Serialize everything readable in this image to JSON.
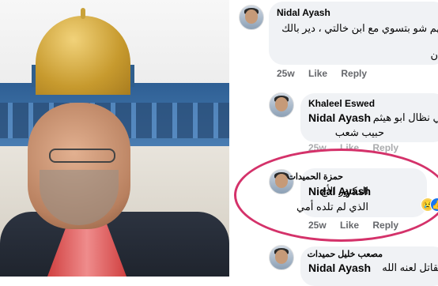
{
  "comments": [
    {
      "author": "Nidal Ayash",
      "text_line1": "يهم شو بتسوي مع ابن خالتي ، دير بالك",
      "text_line2": "ن",
      "age": "25w",
      "like_label": "Like",
      "reply_label": "Reply"
    },
    {
      "author": "Khaleel Eswed",
      "mention": "Nidal Ayash",
      "text_line1": "بي نظال ابو هيثم",
      "text_line2": "حبيب شعب",
      "age": "25w",
      "like_label": "Like",
      "reply_label": "Reply"
    },
    {
      "author": "حمزة الحميدات",
      "mention": "Nidal Ayash",
      "text_line1": "الدكتور الأخ",
      "text_line2": "الذي لم تلده أمي",
      "age": "25w",
      "like_label": "Like",
      "reply_label": "Reply",
      "reactions": [
        "sad-face",
        "like"
      ]
    },
    {
      "author": "مصعب خليل حميدات",
      "mention": "Nidal Ayash",
      "text_line1": "القاتل لعنه الله"
    }
  ],
  "colors": {
    "bubble": "#f0f2f5",
    "meta_text": "#65676b",
    "highlight_circle": "#d4326a"
  }
}
